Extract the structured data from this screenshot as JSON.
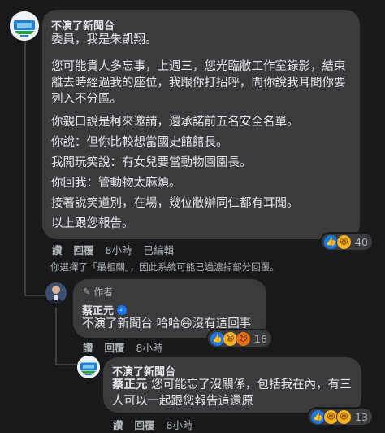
{
  "comment1": {
    "author": "不演了新聞台",
    "paragraphs": [
      "委員，我是朱凱翔。",
      "您可能貴人多忘事，上週三，您光臨敝工作室錄影，結束離去時經過我的座位，我跟你打招呼，問你說我耳聞你要列入不分區。",
      "你親口說是柯來邀請，還承諾前五名安全名單。",
      "你說：但你比較想當國史館館長。",
      "我開玩笑說：有女兒要當動物園園長。",
      "你回我：管動物太麻煩。",
      "接著說笑道別，在場，幾位敝辦同仁都有耳聞。",
      "以上跟您報告。"
    ],
    "actions": {
      "like": "讚",
      "reply": "回覆",
      "time": "8小時",
      "edited": "已編輯"
    },
    "reactions": {
      "count": "40",
      "types": [
        "like-icon",
        "haha-icon"
      ]
    }
  },
  "filter_notice": "你選擇了「最相關」，因此系統可能已過濾掉部分回覆。",
  "reply1": {
    "badge": "作者",
    "author": "蔡正元",
    "text": "不演了新聞台 哈哈😄沒有這回事",
    "actions": {
      "like": "讚",
      "reply": "回覆",
      "time": "8小時"
    },
    "reactions": {
      "count": "16",
      "types": [
        "like-icon",
        "haha-icon",
        "angry-icon"
      ]
    }
  },
  "reply2": {
    "author": "不演了新聞台",
    "mention": "蔡正元",
    "text": " 您可能忘了沒關係，包括我在內，有三人可以一起跟您報告這還原",
    "actions": {
      "like": "讚",
      "reply": "回覆",
      "time": "8小時"
    },
    "reactions": {
      "count": "13",
      "types": [
        "like-icon",
        "haha-icon",
        "haha-icon"
      ]
    }
  },
  "colors": {
    "bg": "#18191a",
    "bubble": "#3a3b3c",
    "text": "#e4e6eb",
    "meta": "#b0b3b8",
    "like": "#1877f2",
    "haha": "#f7b125"
  }
}
